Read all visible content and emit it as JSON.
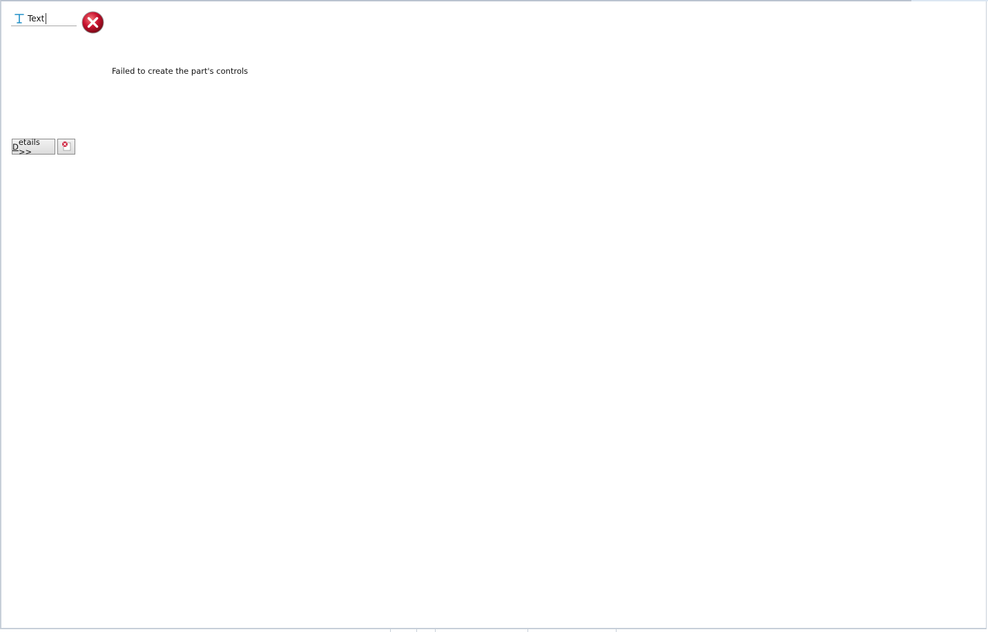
{
  "part_tab": {
    "icon": "text-t-icon",
    "label": "Text"
  },
  "error": {
    "icon": "error-x-icon",
    "message": "Failed to create the part's controls"
  },
  "buttons": {
    "details_mnemonic": "D",
    "details_rest": "etails >>",
    "log_icon": "error-log-icon"
  },
  "colors": {
    "error_red": "#c8102e",
    "text_icon_blue": "#1f8fc7"
  }
}
